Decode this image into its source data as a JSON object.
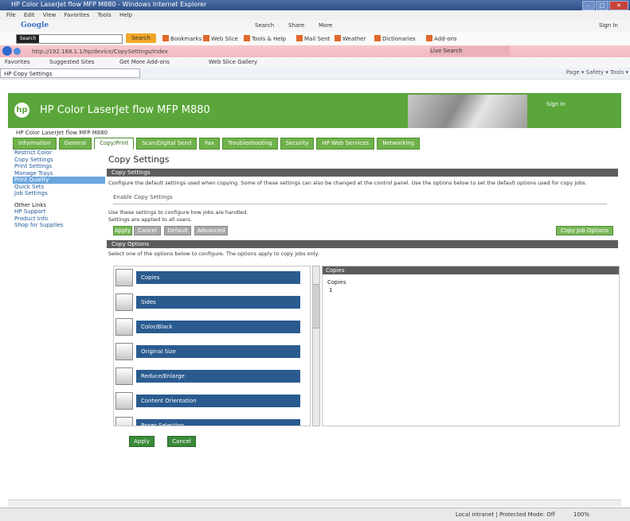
{
  "window": {
    "title": "HP Color LaserJet flow MFP M880 - Windows Internet Explorer"
  },
  "menubar": [
    "File",
    "Edit",
    "View",
    "Favorites",
    "Tools",
    "Help"
  ],
  "google": {
    "logo": "Google",
    "links": [
      "Search",
      "Share",
      "More"
    ],
    "signin": "Sign In"
  },
  "bmbar": {
    "search_dropdown": "Search",
    "search_button": "Search",
    "bookmarks": [
      "Bookmarks",
      "Web Slice",
      "Tools & Help",
      "Mail Sent",
      "Weather",
      "Dictionaries",
      "Add-ons"
    ]
  },
  "address": {
    "url": "http://192.168.1.1/hp/device/CopySettings/Index",
    "search_hint": "Live Search"
  },
  "favorites": {
    "label": "Favorites",
    "links": [
      "Suggested Sites",
      "Get More Add-ons",
      "Web Slice Gallery"
    ]
  },
  "tabs": [
    {
      "label": "HP Copy Settings"
    }
  ],
  "toolbar_icons": "Page ▾  Safety ▾  Tools ▾",
  "header": {
    "logo": "hp",
    "product": "HP Color LaserJet flow MFP M880",
    "signin": "Sign In"
  },
  "breadcrumb": "HP Color LaserJet flow MFP M880",
  "main_tabs": [
    "Information",
    "General",
    "Copy/Print",
    "Scan/Digital Send",
    "Fax",
    "Troubleshooting",
    "Security",
    "HP Web Services",
    "Networking"
  ],
  "subnav": {
    "items": [
      "Restrict Color",
      "Copy Settings",
      "Print Settings",
      "Manage Trays",
      "Print Quality",
      "Quick Sets",
      "Job Settings"
    ],
    "selected": 4,
    "other_head": "Other Links",
    "other_links": [
      "HP Support",
      "Product Info",
      "Shop for Supplies"
    ]
  },
  "page": {
    "title": "Copy Settings",
    "section1": "Copy Settings",
    "info_text": "Configure the default settings used when copying. Some of these settings can also be changed at the control panel. Use the options below to set the default options used for copy jobs.",
    "field_placeholder": "Enable Copy Settings",
    "notes": [
      "Use these settings to configure how jobs are handled.",
      "Settings are applied to all users."
    ],
    "buttons": [
      "Apply",
      "Cancel",
      "Default",
      "Advanced"
    ],
    "right_button": "Copy Job Options",
    "section2": "Copy Options",
    "options_hint": "Select one of the options below to configure. The options apply to copy jobs only."
  },
  "options": [
    "Copies",
    "Sides",
    "Color/Black",
    "Original Size",
    "Reduce/Enlarge",
    "Content Orientation",
    "Paper Selection"
  ],
  "detail": {
    "header": "Copies",
    "label": "Copies",
    "value": "1"
  },
  "footer_buttons": {
    "apply": "Apply",
    "cancel": "Cancel"
  },
  "statusbar": {
    "zone": "Local intranet | Protected Mode: Off",
    "zoom": "100%"
  }
}
